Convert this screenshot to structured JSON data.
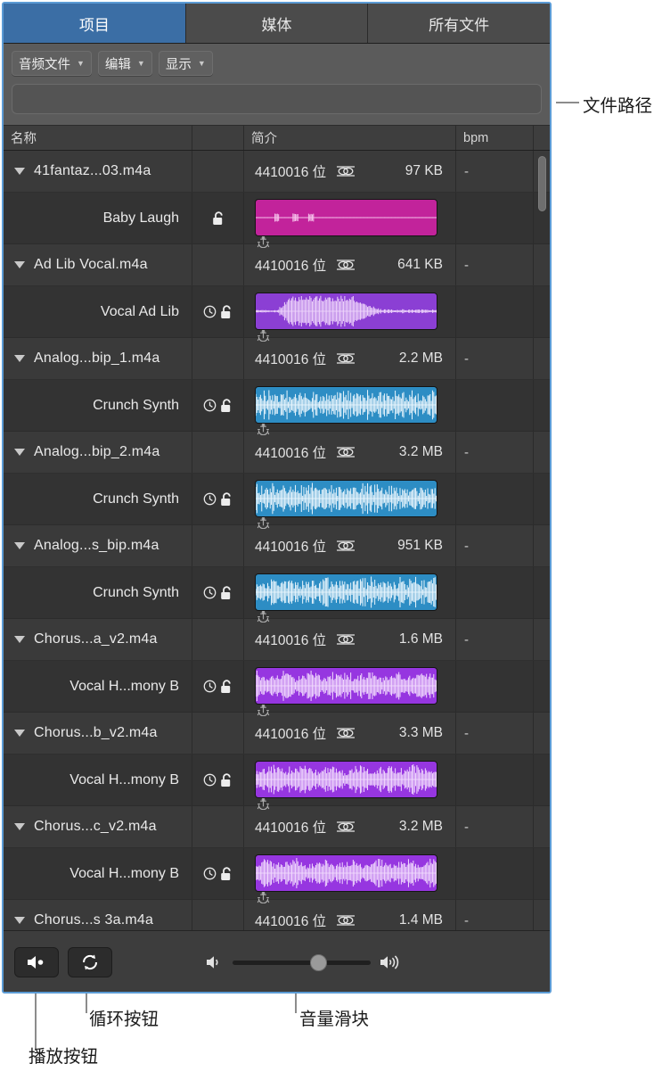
{
  "tabs": [
    {
      "label": "项目",
      "active": true
    },
    {
      "label": "媒体",
      "active": false
    },
    {
      "label": "所有文件",
      "active": false
    }
  ],
  "toolbar": {
    "popups": [
      {
        "label": "音频文件"
      },
      {
        "label": "编辑"
      },
      {
        "label": "显示"
      }
    ],
    "path_value": "",
    "path_placeholder": ""
  },
  "columns": {
    "name": "名称",
    "lock": "",
    "info": "简介",
    "bpm": "bpm",
    "end": ""
  },
  "rows": [
    {
      "file": "41fantaz...03.m4a",
      "format": "4410016 位",
      "channel_icon": "stereo-icon",
      "size": "97 KB",
      "bpm": "-",
      "region": "Baby Laugh",
      "has_clock": false,
      "has_lock": true,
      "wave_fill": "#c2239b",
      "wave_peak": "#f7c6ec",
      "wave_style": "flat"
    },
    {
      "file": "Ad Lib Vocal.m4a",
      "format": "4410016 位",
      "channel_icon": "stereo-icon",
      "size": "641 KB",
      "bpm": "-",
      "region": "Vocal Ad Lib",
      "has_clock": true,
      "has_lock": true,
      "wave_fill": "#8b3fd4",
      "wave_peak": "#efd6fb",
      "wave_style": "swell"
    },
    {
      "file": "Analog...bip_1.m4a",
      "format": "4410016 位",
      "channel_icon": "stereo-icon",
      "size": "2.2 MB",
      "bpm": "-",
      "region": "Crunch Synth",
      "has_clock": true,
      "has_lock": true,
      "wave_fill": "#2d8dc4",
      "wave_peak": "#eaf6fd",
      "wave_style": "dense"
    },
    {
      "file": "Analog...bip_2.m4a",
      "format": "4410016 位",
      "channel_icon": "stereo-icon",
      "size": "3.2 MB",
      "bpm": "-",
      "region": "Crunch Synth",
      "has_clock": true,
      "has_lock": true,
      "wave_fill": "#2d8dc4",
      "wave_peak": "#eaf6fd",
      "wave_style": "dense"
    },
    {
      "file": "Analog...s_bip.m4a",
      "format": "4410016 位",
      "channel_icon": "stereo-icon",
      "size": "951 KB",
      "bpm": "-",
      "region": "Crunch Synth",
      "has_clock": true,
      "has_lock": true,
      "wave_fill": "#2d8dc4",
      "wave_peak": "#eaf6fd",
      "wave_style": "dense"
    },
    {
      "file": "Chorus...a_v2.m4a",
      "format": "4410016 位",
      "channel_icon": "stereo-icon",
      "size": "1.6 MB",
      "bpm": "-",
      "region": "Vocal H...mony B",
      "has_clock": true,
      "has_lock": true,
      "wave_fill": "#9636e0",
      "wave_peak": "#f2dcfd",
      "wave_style": "vocal"
    },
    {
      "file": "Chorus...b_v2.m4a",
      "format": "4410016 位",
      "channel_icon": "stereo-icon",
      "size": "3.3 MB",
      "bpm": "-",
      "region": "Vocal H...mony B",
      "has_clock": true,
      "has_lock": true,
      "wave_fill": "#9636e0",
      "wave_peak": "#f2dcfd",
      "wave_style": "vocal"
    },
    {
      "file": "Chorus...c_v2.m4a",
      "format": "4410016 位",
      "channel_icon": "stereo-icon",
      "size": "3.2 MB",
      "bpm": "-",
      "region": "Vocal H...mony B",
      "has_clock": true,
      "has_lock": true,
      "wave_fill": "#9636e0",
      "wave_peak": "#f2dcfd",
      "wave_style": "vocal"
    },
    {
      "file": "Chorus...s 3a.m4a",
      "format": "4410016 位",
      "channel_icon": "stereo-icon",
      "size": "1.4 MB",
      "bpm": "-",
      "region": "",
      "has_clock": false,
      "has_lock": false,
      "wave_fill": "#9636e0",
      "wave_peak": "#f2dcfd",
      "wave_style": "clipped"
    }
  ],
  "transport": {
    "play_icon": "speaker-play-icon",
    "loop_icon": "loop-icon",
    "volume_low_icon": "volume-low-icon",
    "volume_high_icon": "volume-high-icon",
    "volume_percent": 62
  },
  "callouts": [
    {
      "id": "file-path",
      "label": "文件路径"
    },
    {
      "id": "loop-button",
      "label": "循环按钮"
    },
    {
      "id": "volume-slider",
      "label": "音量滑块"
    },
    {
      "id": "play-button",
      "label": "播放按钮"
    }
  ],
  "colors": {
    "accent": "#5b9bd5",
    "active_tab": "#3b6ea5",
    "window_bg": "#333333",
    "toolbar_bg": "#5b5b5b"
  }
}
